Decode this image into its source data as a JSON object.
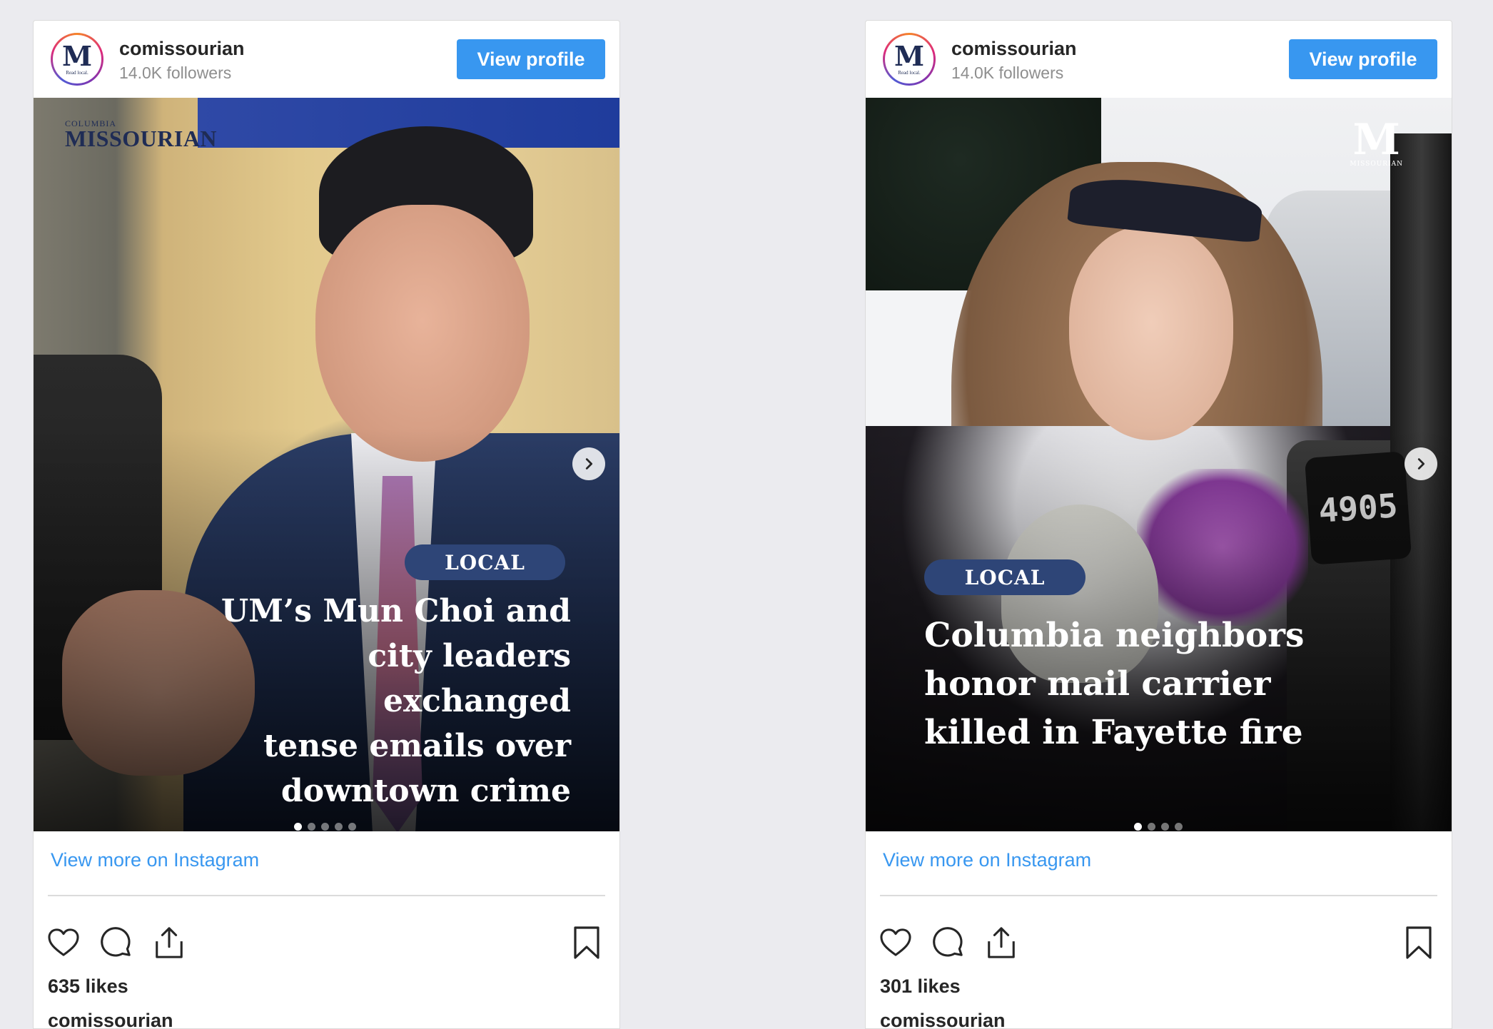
{
  "posts": [
    {
      "account": {
        "username": "comissourian",
        "followers": "14.0K followers",
        "avatar_letter": "M",
        "avatar_tagline": "Read local."
      },
      "view_profile_label": "View profile",
      "media": {
        "brand_logo_small": "COLUMBIA",
        "brand_logo_big": "MISSOURIAN",
        "tag": "LOCAL",
        "headline_lines": [
          "UM’s Mun Choi and",
          "city leaders exchanged",
          "tense emails over",
          "downtown crime"
        ],
        "slide_count": 5,
        "active_slide": 1
      },
      "view_more_label": "View more on Instagram",
      "likes": "635 likes",
      "caption_username": "comissourian"
    },
    {
      "account": {
        "username": "comissourian",
        "followers": "14.0K followers",
        "avatar_letter": "M",
        "avatar_tagline": "Read local."
      },
      "view_profile_label": "View profile",
      "media": {
        "brand_logo_big": "M",
        "brand_logo_small": "MISSOURIAN",
        "house_number": "4905",
        "tag": "LOCAL",
        "headline_lines": [
          "Columbia neighbors",
          "honor mail carrier",
          "killed in Fayette fire"
        ],
        "slide_count": 4,
        "active_slide": 1
      },
      "view_more_label": "View more on Instagram",
      "likes": "301 likes",
      "caption_username": "comissourian"
    }
  ],
  "colors": {
    "page_background": "#ebebef",
    "link_blue": "#3897f0",
    "tag_navy": "#2e4577",
    "text_dark": "#262626",
    "text_muted": "#8e8e8e"
  },
  "icons": [
    "heart-icon",
    "comment-icon",
    "share-icon",
    "bookmark-icon",
    "chevron-right-icon"
  ]
}
